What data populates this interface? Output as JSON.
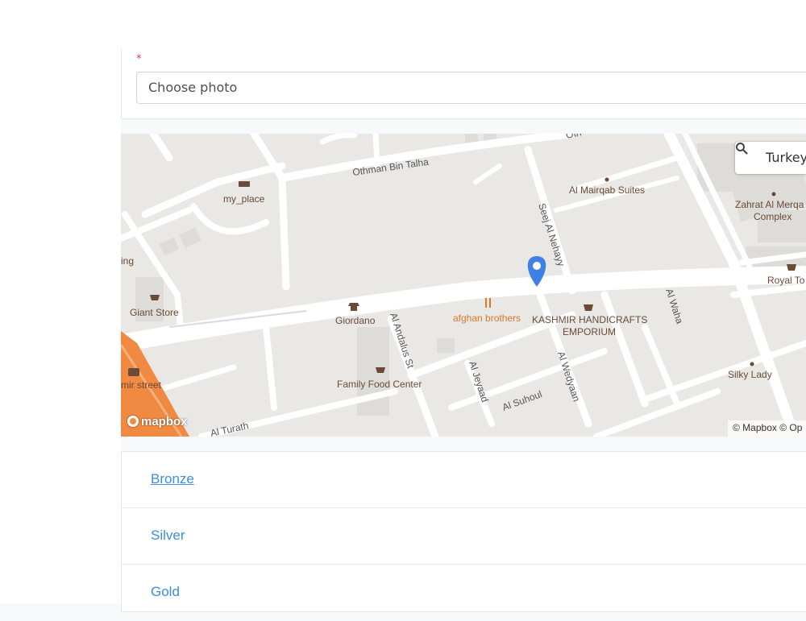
{
  "form": {
    "required_marker": "*",
    "photo_input_label": "Choose photo"
  },
  "map": {
    "search_value": "Turkey",
    "mapbox_logo": "mapbox",
    "attribution": "© Mapbox © Op",
    "places": {
      "my_place": "my_place",
      "al_mairqab": "Al Mairqab Suites",
      "zahrat_line1": "Zahrat Al Merqa",
      "zahrat_line2": "Complex",
      "giant_store": "Giant Store",
      "giordano": "Giordano",
      "afghan": "afghan brothers",
      "kashmir_line1": "KASHMIR HANDICRAFTS",
      "kashmir_line2": "EMPORIUM",
      "royal": "Royal To",
      "family_food": "Family Food Center",
      "silky_lady": "Silky Lady",
      "ing": "ing",
      "mir_street": "mir street"
    },
    "streets": {
      "othman": "Othman Bin Talha",
      "seej": "Seej Al Nehayy",
      "andalus": "Al Andalus St",
      "jeyaad": "Al Jeyaad",
      "wedyaan": "Al Wedyaan",
      "suhoul": "Al Suhoul",
      "waha": "Al Waha",
      "turath": "Al Turath",
      "oth": "Oth"
    },
    "colors": {
      "land": "#e9e8e4",
      "block": "#dddcd8",
      "road": "#ffffff",
      "highway": "#f08a42",
      "marker": "#3f7fe6"
    }
  },
  "tiers": [
    {
      "label": "Bronze",
      "active": true
    },
    {
      "label": "Silver",
      "active": false
    },
    {
      "label": "Gold",
      "active": false
    }
  ]
}
